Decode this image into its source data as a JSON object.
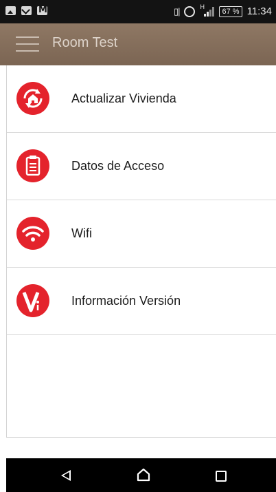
{
  "status_bar": {
    "battery": "67 %",
    "time": "11:34",
    "network_type": "H",
    "icons": [
      "image-icon",
      "mail-icon",
      "gmail-icon",
      "vibrate-icon",
      "alarm-icon",
      "signal-icon",
      "battery-icon"
    ]
  },
  "app_bar": {
    "title": "Room Test",
    "menu_icon": "hamburger-menu-icon",
    "background": "#857060"
  },
  "menu": {
    "accent_color": "#e4232c",
    "items": [
      {
        "label": "Actualizar Vivienda",
        "icon": "refresh-home-icon"
      },
      {
        "label": "Datos de Acceso",
        "icon": "clipboard-icon"
      },
      {
        "label": "Wifi",
        "icon": "wifi-icon"
      },
      {
        "label": "Información Versión",
        "icon": "version-info-icon"
      }
    ]
  },
  "nav_bar": {
    "buttons": [
      "back-icon",
      "home-icon",
      "recent-apps-icon"
    ]
  }
}
